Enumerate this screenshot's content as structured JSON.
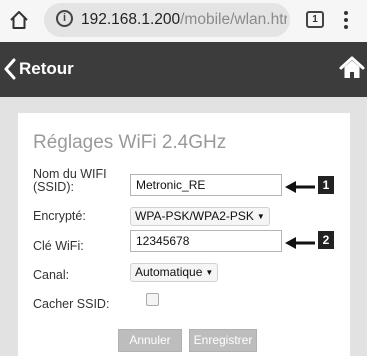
{
  "browser": {
    "url_host": "192.168.1.200",
    "url_path": "/mobile/wlan.htr",
    "tab_count": "1",
    "info_glyph": "i",
    "icons": [
      "home-icon",
      "info-icon",
      "tabs-icon",
      "more-vert-icon"
    ]
  },
  "header": {
    "back_label": "Retour",
    "icons": [
      "chevron-left-icon",
      "home-icon"
    ]
  },
  "form": {
    "title": "Réglages WiFi 2.4GHz",
    "ssid_label_line1": "Nom du WIFI",
    "ssid_label_line2": "(SSID):",
    "ssid_value": "Metronic_RE",
    "encryption_label": "Encrypté:",
    "encryption_value": "WPA-PSK/WPA2-PSK",
    "key_label": "Clé WiFi:",
    "key_value": "12345678",
    "channel_label": "Canal:",
    "channel_value": "Automatique",
    "hide_ssid_label": "Cacher SSID:",
    "hide_ssid_checked": false,
    "cancel_label": "Annuler",
    "save_label": "Enregistrer"
  },
  "callouts": [
    "1",
    "2"
  ],
  "colors": {
    "header_bg": "#3c3c3c",
    "page_bg": "#e2e2e2",
    "button_bg": "#bdbdbd",
    "title_text": "#9a9a9a"
  }
}
